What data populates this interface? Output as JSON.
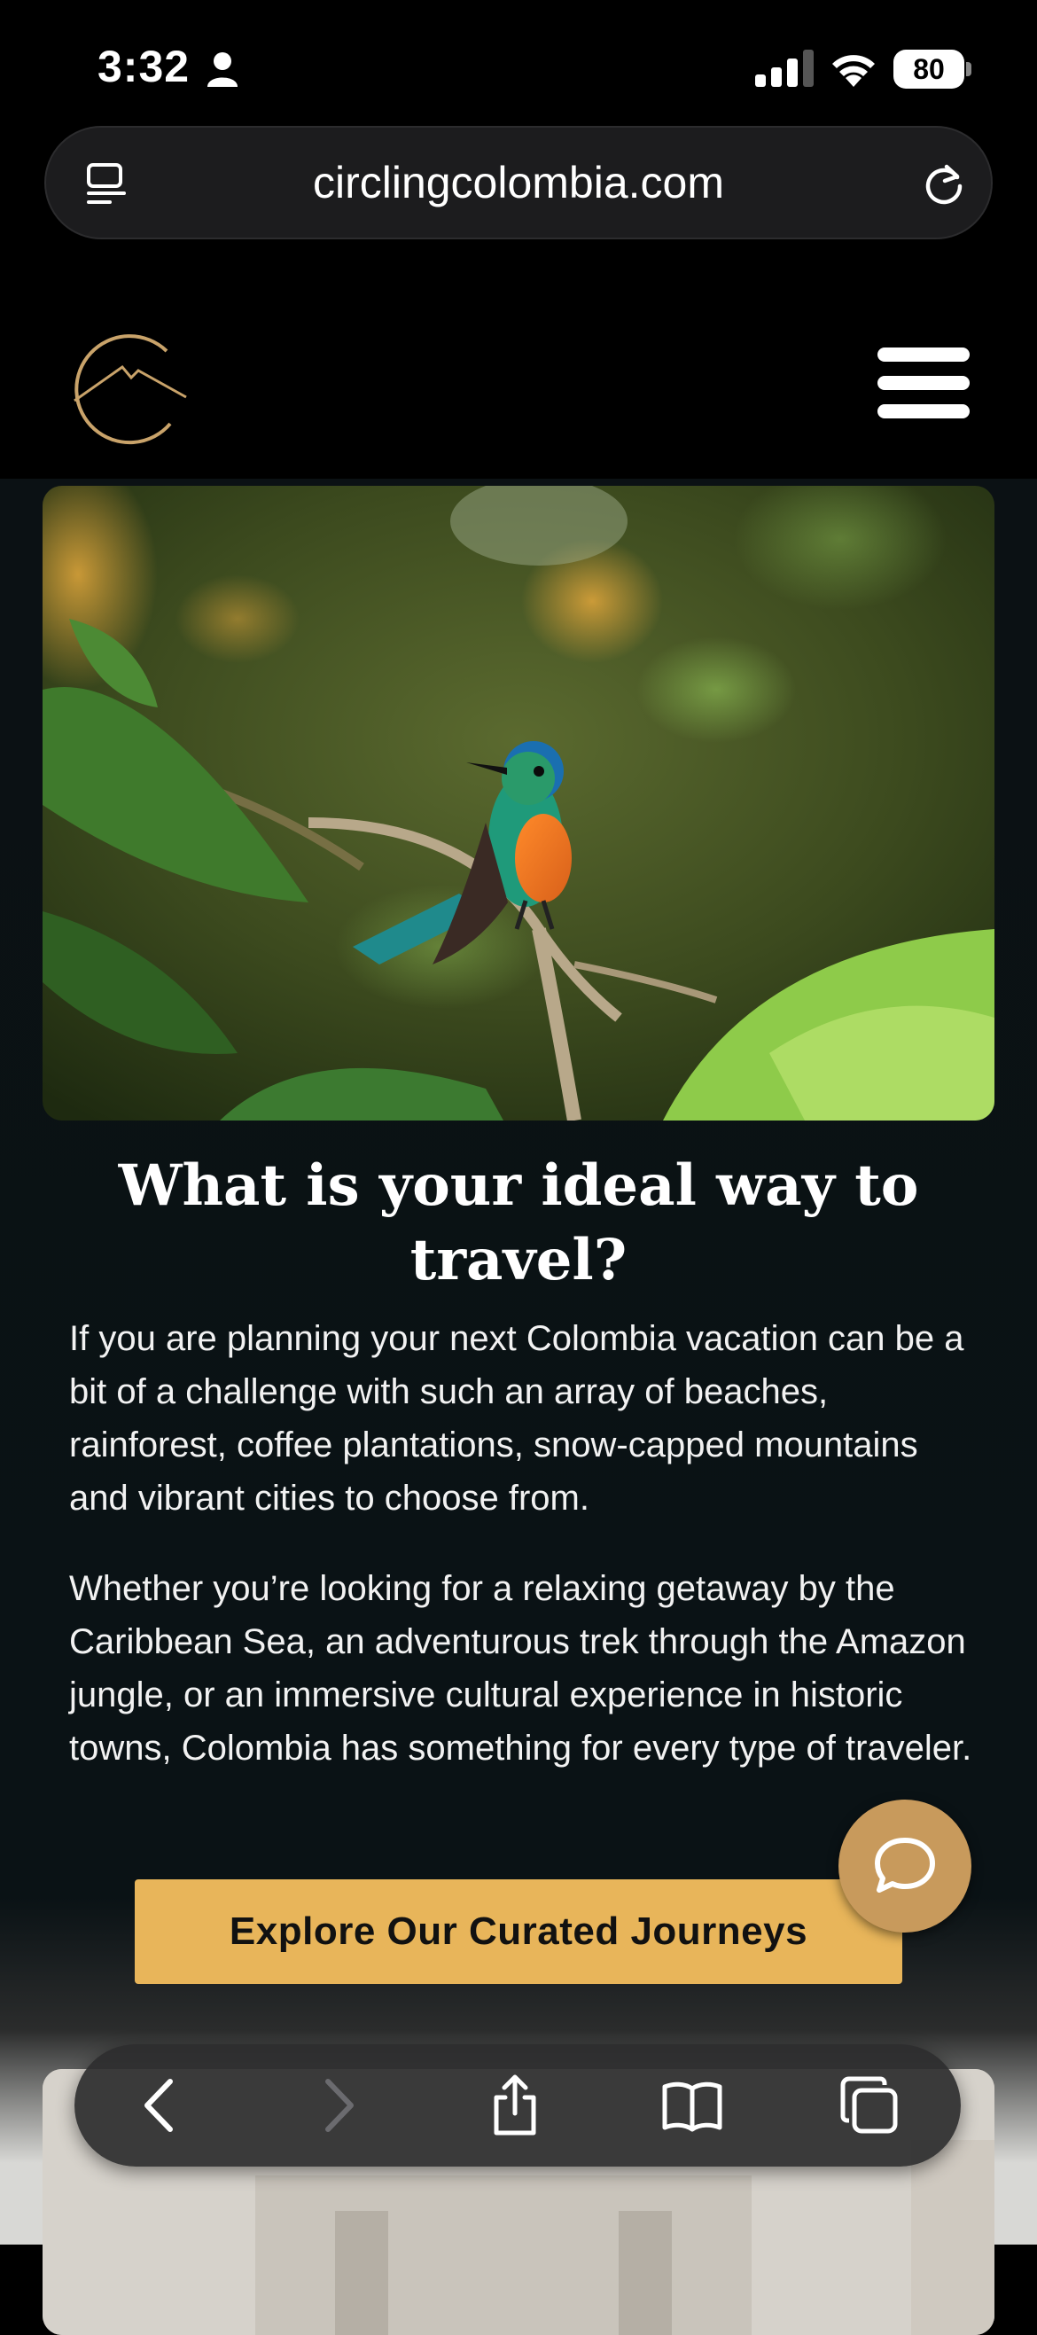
{
  "status_bar": {
    "time": "3:32",
    "battery": "80"
  },
  "browser": {
    "url": "circlingcolombia.com"
  },
  "content": {
    "headline": "What is your ideal way to travel?",
    "paragraph_1": "If you are planning your next Colombia vacation can be a bit of a challenge with such an array of beaches, rainforest, coffee plantations, snow-capped mountains and vibrant cities to choose from.",
    "paragraph_2": "Whether you’re looking for a relaxing getaway by the Caribbean Sea, an adventurous trek through the Amazon jungle, or an immersive cultural experience in historic towns, Colombia has something for every type of traveler.",
    "cta_label": "Explore Our Curated Journeys"
  },
  "icons": [
    "person-icon",
    "signal-icon",
    "wifi-icon",
    "reader-icon",
    "reload-icon",
    "logo-icon",
    "menu-icon",
    "chat-icon",
    "back-icon",
    "forward-icon",
    "share-icon",
    "bookmarks-icon",
    "tabs-icon"
  ],
  "colors": {
    "accent": "#e8b55a",
    "chat": "#c89a5c",
    "logo_gold": "#c9a36a",
    "background": "#0b1114"
  }
}
